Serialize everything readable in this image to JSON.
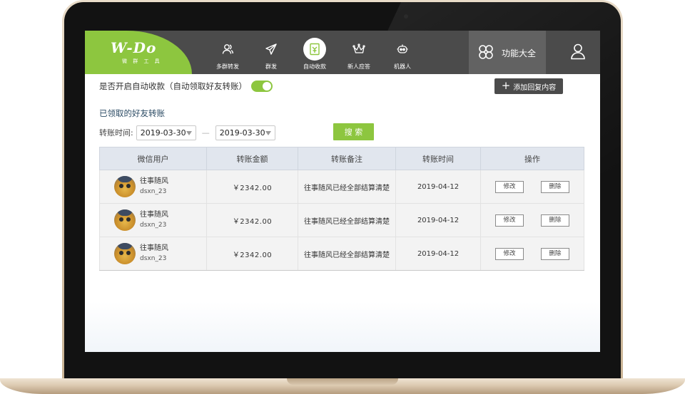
{
  "brand": {
    "logo": "W-Do",
    "subtitle": "微 群 工 具",
    "color": "#8dc63f"
  },
  "nav": {
    "items": [
      {
        "label": "多群转发",
        "icon": "users-icon"
      },
      {
        "label": "群发",
        "icon": "paper-plane-icon"
      },
      {
        "label": "自动收款",
        "icon": "payment-doc-icon",
        "active": true
      },
      {
        "label": "新人应答",
        "icon": "crown-icon"
      },
      {
        "label": "机器人",
        "icon": "robot-icon"
      }
    ],
    "feature_label": "功能大全",
    "feature_icon": "clover-icon",
    "user_icon": "user-icon"
  },
  "auto_collect": {
    "label": "是否开启自动收款（自动领取好友转账）",
    "enabled": true,
    "add_reply_label": "添加回复内容"
  },
  "section_title": "已领取的好友转账",
  "filter": {
    "label": "转账时间:",
    "start_date": "2019-03-30",
    "separator": "—",
    "end_date": "2019-03-30",
    "search_label": "搜 索"
  },
  "table": {
    "headers": [
      "微信用户",
      "转账金额",
      "转账备注",
      "转账时间",
      "操作"
    ],
    "rows": [
      {
        "name": "往事随风",
        "id": "dsxn_23",
        "amount": "￥2342.00",
        "note": "往事随风已经全部结算清楚",
        "date": "2019-04-12",
        "edit": "修改",
        "delete": "删除"
      },
      {
        "name": "往事随风",
        "id": "dsxn_23",
        "amount": "￥2342.00",
        "note": "往事随风已经全部结算清楚",
        "date": "2019-04-12",
        "edit": "修改",
        "delete": "删除"
      },
      {
        "name": "往事随风",
        "id": "dsxn_23",
        "amount": "￥2342.00",
        "note": "往事随风已经全部结算清楚",
        "date": "2019-04-12",
        "edit": "修改",
        "delete": "删除"
      }
    ]
  },
  "colors": {
    "accent": "#8dc63f",
    "nav_bg": "#4b4b4b",
    "header_bg": "#e1e6ee"
  }
}
